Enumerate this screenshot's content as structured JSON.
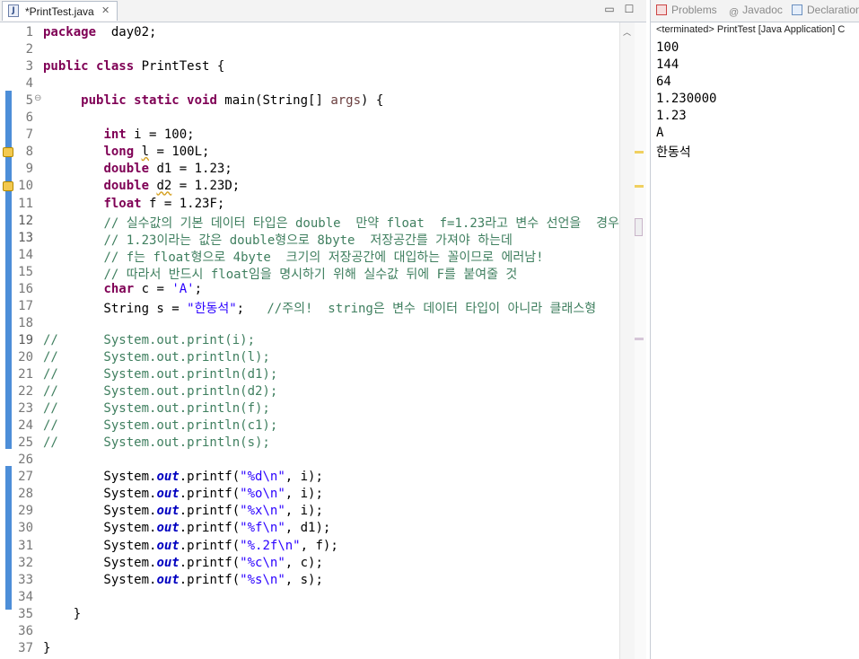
{
  "editor": {
    "tab_label": "*PrintTest.java",
    "tab_icon": "java-file-icon",
    "lines": [
      {
        "n": "1",
        "segs": [
          [
            "kw",
            "package"
          ],
          [
            "",
            "  day02;"
          ]
        ]
      },
      {
        "n": "2",
        "segs": []
      },
      {
        "n": "3",
        "segs": [
          [
            "kw",
            "public class"
          ],
          [
            "",
            " PrintTest {"
          ]
        ]
      },
      {
        "n": "4",
        "segs": []
      },
      {
        "n": "5",
        "segs": [
          [
            "",
            "     "
          ],
          [
            "kw",
            "public static void"
          ],
          [
            "",
            " main(String[] "
          ],
          [
            "lvar",
            "args"
          ],
          [
            "",
            ") {"
          ]
        ]
      },
      {
        "n": "6",
        "segs": []
      },
      {
        "n": "7",
        "segs": [
          [
            "",
            "        "
          ],
          [
            "kw",
            "int"
          ],
          [
            "",
            " i = 100;"
          ]
        ]
      },
      {
        "n": "8",
        "segs": [
          [
            "",
            "        "
          ],
          [
            "kw",
            "long"
          ],
          [
            "",
            " "
          ],
          [
            "wavy",
            "l"
          ],
          [
            "",
            " = 100L;"
          ]
        ]
      },
      {
        "n": "9",
        "segs": [
          [
            "",
            "        "
          ],
          [
            "kw",
            "double"
          ],
          [
            "",
            " d1 = 1.23;"
          ]
        ]
      },
      {
        "n": "10",
        "segs": [
          [
            "",
            "        "
          ],
          [
            "kw",
            "double"
          ],
          [
            "",
            " "
          ],
          [
            "wavy",
            "d2"
          ],
          [
            "",
            " = 1.23D;"
          ]
        ]
      },
      {
        "n": "11",
        "segs": [
          [
            "",
            "        "
          ],
          [
            "kw",
            "float"
          ],
          [
            "",
            " f = 1.23F;"
          ]
        ]
      },
      {
        "n": "12",
        "segs": [
          [
            "",
            "        "
          ],
          [
            "cm",
            "// 실수값의 기본 데이터 타입은 double  만약 float  f=1.23라고 변수 선언을  경우"
          ]
        ]
      },
      {
        "n": "13",
        "segs": [
          [
            "",
            "        "
          ],
          [
            "cm",
            "// 1.23이라는 값은 double형으로 8byte  저장공간를 가져야 하는데"
          ]
        ]
      },
      {
        "n": "14",
        "segs": [
          [
            "",
            "        "
          ],
          [
            "cm",
            "// f는 float형으로 4byte  크기의 저장공간에 대입하는 꼴이므로 에러남!"
          ]
        ]
      },
      {
        "n": "15",
        "segs": [
          [
            "",
            "        "
          ],
          [
            "cm",
            "// 따라서 반드시 float임을 명시하기 위해 실수값 뒤에 F를 붙여줄 것"
          ]
        ]
      },
      {
        "n": "16",
        "segs": [
          [
            "",
            "        "
          ],
          [
            "kw",
            "char"
          ],
          [
            "",
            " c = "
          ],
          [
            "str",
            "'A'"
          ],
          [
            "",
            ";"
          ]
        ]
      },
      {
        "n": "17",
        "segs": [
          [
            "",
            "        String s = "
          ],
          [
            "str",
            "\"한동석\""
          ],
          [
            "",
            ";   "
          ],
          [
            "cm",
            "//주의!  string은 변수 데이터 타입이 아니라 클래스형"
          ]
        ]
      },
      {
        "n": "18",
        "segs": []
      },
      {
        "n": "19",
        "segs": [
          [
            "cm",
            "//      System.out.print(i);"
          ]
        ]
      },
      {
        "n": "20",
        "segs": [
          [
            "cm",
            "//      System.out.println(l);"
          ]
        ]
      },
      {
        "n": "21",
        "segs": [
          [
            "cm",
            "//      System.out.println(d1);"
          ]
        ]
      },
      {
        "n": "22",
        "segs": [
          [
            "cm",
            "//      System.out.println(d2);"
          ]
        ]
      },
      {
        "n": "23",
        "segs": [
          [
            "cm",
            "//      System.out.println(f);"
          ]
        ]
      },
      {
        "n": "24",
        "segs": [
          [
            "cm",
            "//      System.out.println(c1);"
          ]
        ]
      },
      {
        "n": "25",
        "segs": [
          [
            "cm",
            "//      System.out.println(s);"
          ]
        ]
      },
      {
        "n": "26",
        "segs": []
      },
      {
        "n": "27",
        "segs": [
          [
            "",
            "        System."
          ],
          [
            "fld",
            "out"
          ],
          [
            "",
            ".printf("
          ],
          [
            "str",
            "\"%d\\n\""
          ],
          [
            "",
            ", i);"
          ]
        ]
      },
      {
        "n": "28",
        "segs": [
          [
            "",
            "        System."
          ],
          [
            "fld",
            "out"
          ],
          [
            "",
            ".printf("
          ],
          [
            "str",
            "\"%o\\n\""
          ],
          [
            "",
            ", i);"
          ]
        ]
      },
      {
        "n": "29",
        "segs": [
          [
            "",
            "        System."
          ],
          [
            "fld",
            "out"
          ],
          [
            "",
            ".printf("
          ],
          [
            "str",
            "\"%x\\n\""
          ],
          [
            "",
            ", i);"
          ]
        ]
      },
      {
        "n": "30",
        "segs": [
          [
            "",
            "        System."
          ],
          [
            "fld",
            "out"
          ],
          [
            "",
            ".printf("
          ],
          [
            "str",
            "\"%f\\n\""
          ],
          [
            "",
            ", d1);"
          ]
        ]
      },
      {
        "n": "31",
        "segs": [
          [
            "",
            "        System."
          ],
          [
            "fld",
            "out"
          ],
          [
            "",
            ".printf("
          ],
          [
            "str",
            "\"%.2f\\n\""
          ],
          [
            "",
            ", f);"
          ]
        ]
      },
      {
        "n": "32",
        "segs": [
          [
            "",
            "        System."
          ],
          [
            "fld",
            "out"
          ],
          [
            "",
            ".printf("
          ],
          [
            "str",
            "\"%c\\n\""
          ],
          [
            "",
            ", c);"
          ]
        ]
      },
      {
        "n": "33",
        "segs": [
          [
            "",
            "        System."
          ],
          [
            "fld",
            "out"
          ],
          [
            "",
            ".printf("
          ],
          [
            "str",
            "\"%s\\n\""
          ],
          [
            "",
            ", s);"
          ]
        ]
      },
      {
        "n": "34",
        "segs": []
      },
      {
        "n": "35",
        "segs": [
          [
            "",
            "    }"
          ]
        ]
      },
      {
        "n": "36",
        "segs": []
      },
      {
        "n": "37",
        "segs": [
          [
            "",
            "}"
          ]
        ]
      }
    ]
  },
  "console": {
    "tabs": [
      {
        "label": "Problems",
        "icon": "problems-icon"
      },
      {
        "label": "Javadoc",
        "icon": "javadoc-icon"
      },
      {
        "label": "Declaration",
        "icon": "declaration-icon"
      }
    ],
    "status": "<terminated> PrintTest [Java Application] C",
    "output": [
      "100",
      "144",
      "64",
      "1.230000",
      "1.23",
      "A",
      "한동석"
    ]
  },
  "colors": {
    "keyword": "#7f0055",
    "string": "#2a00ff",
    "comment": "#3f7f5f",
    "field": "#0000c0",
    "change_bar": "#4d8ed8"
  }
}
